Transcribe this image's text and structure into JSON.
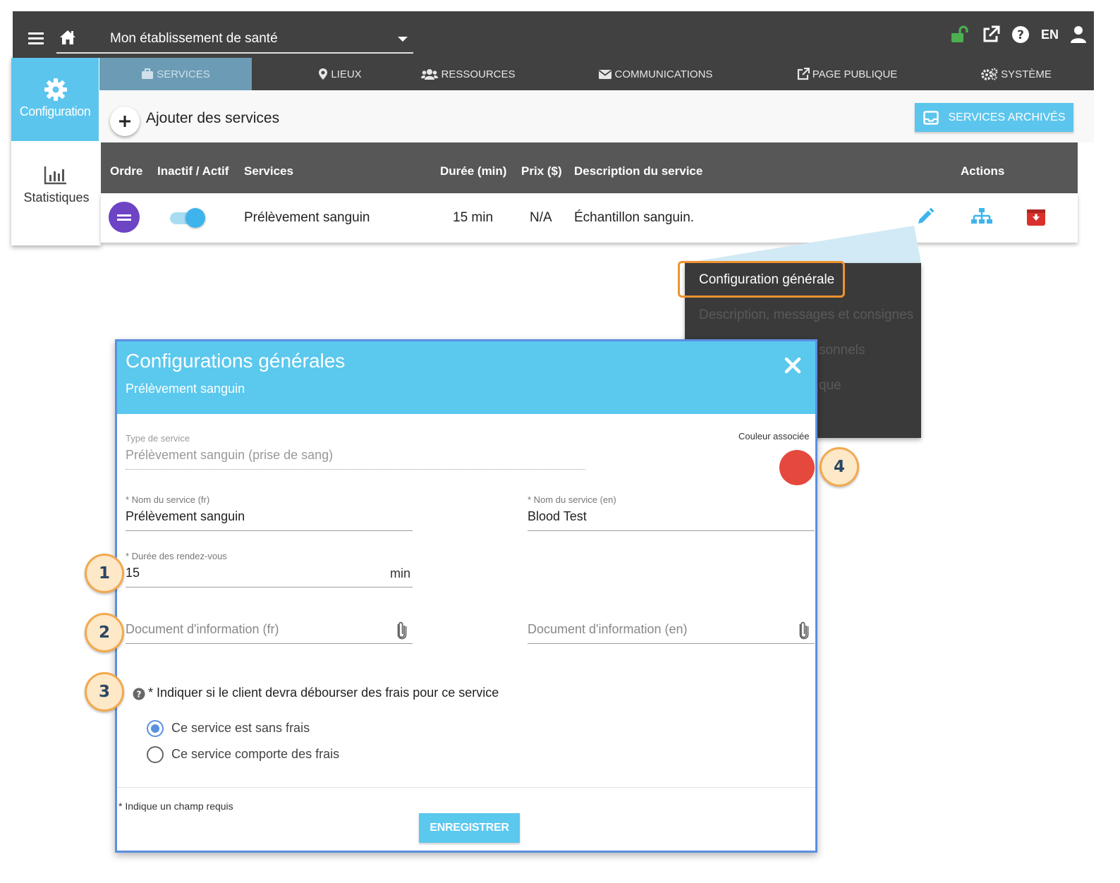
{
  "topbar": {
    "facility": "Mon établissement de santé",
    "language": "EN"
  },
  "side": {
    "config_label": "Configuration",
    "stats_label": "Statistiques"
  },
  "tabs": [
    {
      "label": "SERVICES",
      "icon": "briefcase-icon"
    },
    {
      "label": "LIEUX",
      "icon": "map-marker-icon"
    },
    {
      "label": "RESSOURCES",
      "icon": "users-icon"
    },
    {
      "label": "COMMUNICATIONS",
      "icon": "envelope-icon"
    },
    {
      "label": "PAGE PUBLIQUE",
      "icon": "external-link-icon"
    },
    {
      "label": "SYSTÈME",
      "icon": "gears-icon"
    }
  ],
  "toolbar": {
    "add_label": "Ajouter des services",
    "archived_label": "SERVICES ARCHIVÉS"
  },
  "table": {
    "headers": [
      "Ordre",
      "Inactif / Actif",
      "Services",
      "Durée (min)",
      "Prix ($)",
      "Description du service",
      "Actions"
    ],
    "row": {
      "service": "Prélèvement sanguin",
      "duration": "15 min",
      "price": "N/A",
      "description": "Échantillon sanguin.",
      "active": true
    }
  },
  "dropdown": {
    "items": [
      "Configuration générale",
      "Description, messages et consignes",
      "sonnels",
      "que"
    ]
  },
  "modal": {
    "title": "Configurations générales",
    "subtitle": "Prélèvement sanguin",
    "service_type_label": "Type de service",
    "service_type_value": "Prélèvement sanguin (prise de sang)",
    "color_label": "Couleur associée",
    "color": "#e5483d",
    "name_fr_label": "* Nom du service (fr)",
    "name_fr_value": "Prélèvement sanguin",
    "name_en_label": "* Nom du service (en)",
    "name_en_value": "Blood Test",
    "duration_label": "* Durée des rendez-vous",
    "duration_value": "15",
    "duration_unit": "min",
    "doc_fr_placeholder": "Document d'information (fr)",
    "doc_en_placeholder": "Document d'information (en)",
    "fee_question": "* Indiquer si le client devra débourser des frais pour ce service",
    "fee_options": [
      "Ce service est sans frais",
      "Ce service comporte des frais"
    ],
    "fee_selected": 0,
    "required_note": "* Indique un champ requis",
    "save_label": "ENREGISTRER"
  },
  "badges": [
    "1",
    "2",
    "3",
    "4"
  ],
  "colors": {
    "accent": "#5bc5ed",
    "dark": "#414141",
    "highlight": "#f0922e",
    "order_button": "#6c44c4",
    "archive_red": "#d9302c"
  }
}
